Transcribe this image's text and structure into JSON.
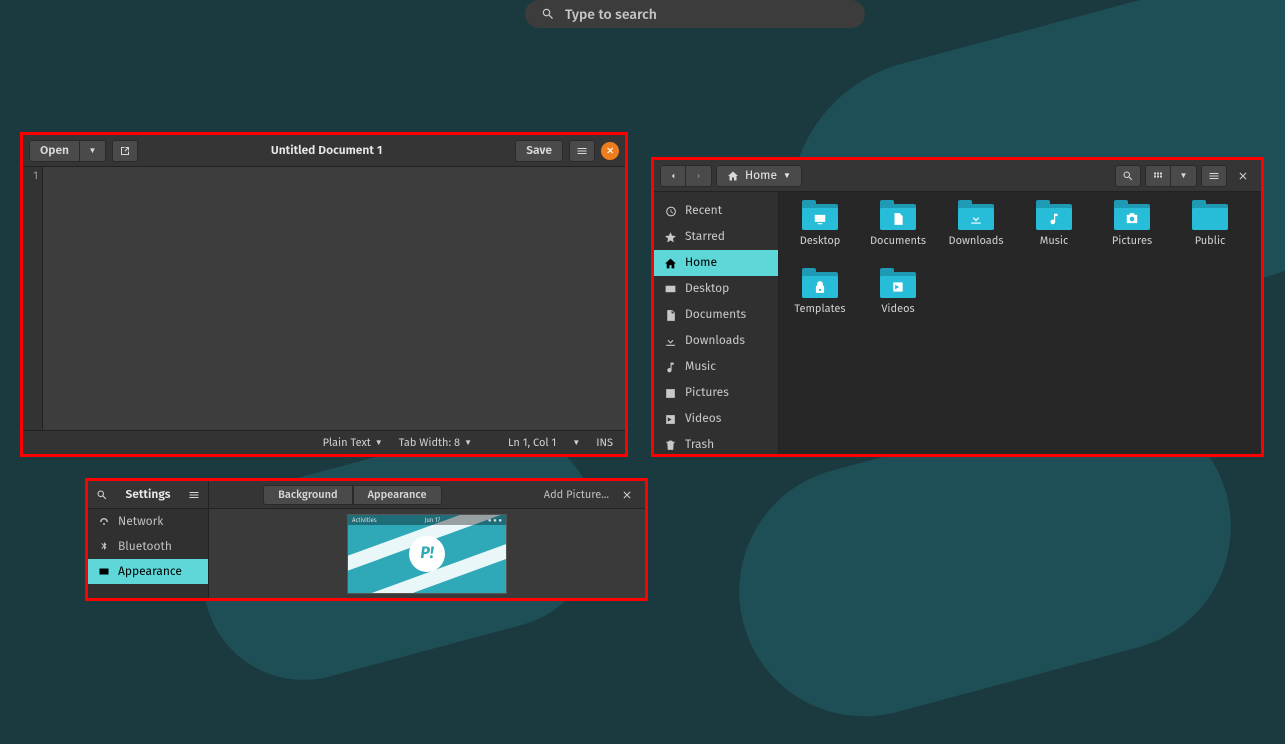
{
  "search": {
    "placeholder": "Type to search"
  },
  "gedit": {
    "open_label": "Open",
    "save_label": "Save",
    "title": "Untitled Document 1",
    "line_number": "1",
    "status": {
      "syntax": "Plain Text",
      "tab_width": "Tab Width: 8",
      "position": "Ln 1, Col 1",
      "mode": "INS"
    }
  },
  "files": {
    "location": "Home",
    "sidebar": [
      {
        "label": "Recent"
      },
      {
        "label": "Starred"
      },
      {
        "label": "Home"
      },
      {
        "label": "Desktop"
      },
      {
        "label": "Documents"
      },
      {
        "label": "Downloads"
      },
      {
        "label": "Music"
      },
      {
        "label": "Pictures"
      },
      {
        "label": "Videos"
      },
      {
        "label": "Trash"
      }
    ],
    "folders": [
      {
        "label": "Desktop"
      },
      {
        "label": "Documents"
      },
      {
        "label": "Downloads"
      },
      {
        "label": "Music"
      },
      {
        "label": "Pictures"
      },
      {
        "label": "Public"
      },
      {
        "label": "Templates"
      },
      {
        "label": "Videos"
      }
    ]
  },
  "settings": {
    "title": "Settings",
    "tabs": {
      "bg": "Background",
      "ap": "Appearance"
    },
    "add_picture": "Add Picture...",
    "sidebar": [
      {
        "label": "Network"
      },
      {
        "label": "Bluetooth"
      },
      {
        "label": "Appearance"
      }
    ],
    "thumb": {
      "left": "Activities",
      "center": "Jun 17",
      "logo": "P!"
    }
  }
}
